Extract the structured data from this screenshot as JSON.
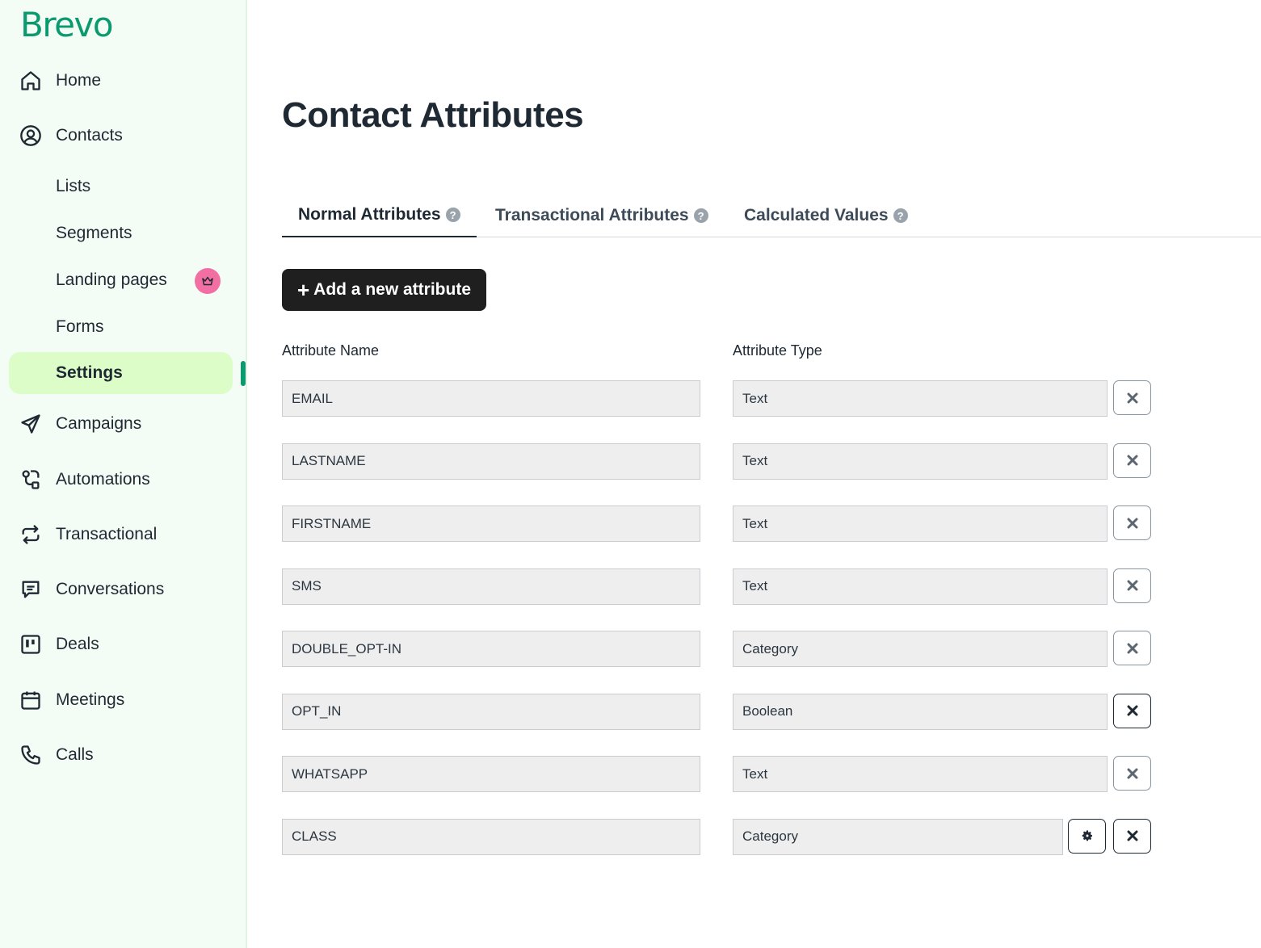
{
  "brand": {
    "name": "Brevo",
    "color": "#0b996e"
  },
  "sidebar": {
    "items": [
      {
        "label": "Home",
        "icon": "home-icon"
      },
      {
        "label": "Contacts",
        "icon": "user-circle-icon"
      },
      {
        "label": "Lists"
      },
      {
        "label": "Segments"
      },
      {
        "label": "Landing pages",
        "badge": "crown-icon"
      },
      {
        "label": "Forms"
      },
      {
        "label": "Settings",
        "active": true
      },
      {
        "label": "Campaigns",
        "icon": "send-icon"
      },
      {
        "label": "Automations",
        "icon": "automation-icon"
      },
      {
        "label": "Transactional",
        "icon": "repeat-icon"
      },
      {
        "label": "Conversations",
        "icon": "chat-icon"
      },
      {
        "label": "Deals",
        "icon": "board-icon"
      },
      {
        "label": "Meetings",
        "icon": "calendar-icon"
      },
      {
        "label": "Calls",
        "icon": "phone-icon"
      }
    ]
  },
  "main": {
    "title": "Contact Attributes",
    "tabs": [
      {
        "label": "Normal Attributes",
        "active": true
      },
      {
        "label": "Transactional Attributes"
      },
      {
        "label": "Calculated Values"
      }
    ],
    "add_button": "Add a new attribute",
    "columns": {
      "name": "Attribute Name",
      "type": "Attribute Type"
    },
    "rows": [
      {
        "name": "EMAIL",
        "type": "Text"
      },
      {
        "name": "LASTNAME",
        "type": "Text"
      },
      {
        "name": "FIRSTNAME",
        "type": "Text"
      },
      {
        "name": "SMS",
        "type": "Text"
      },
      {
        "name": "DOUBLE_OPT-IN",
        "type": "Category"
      },
      {
        "name": "OPT_IN",
        "type": "Boolean"
      },
      {
        "name": "WHATSAPP",
        "type": "Text"
      },
      {
        "name": "CLASS",
        "type": "Category",
        "settings": true
      }
    ]
  }
}
